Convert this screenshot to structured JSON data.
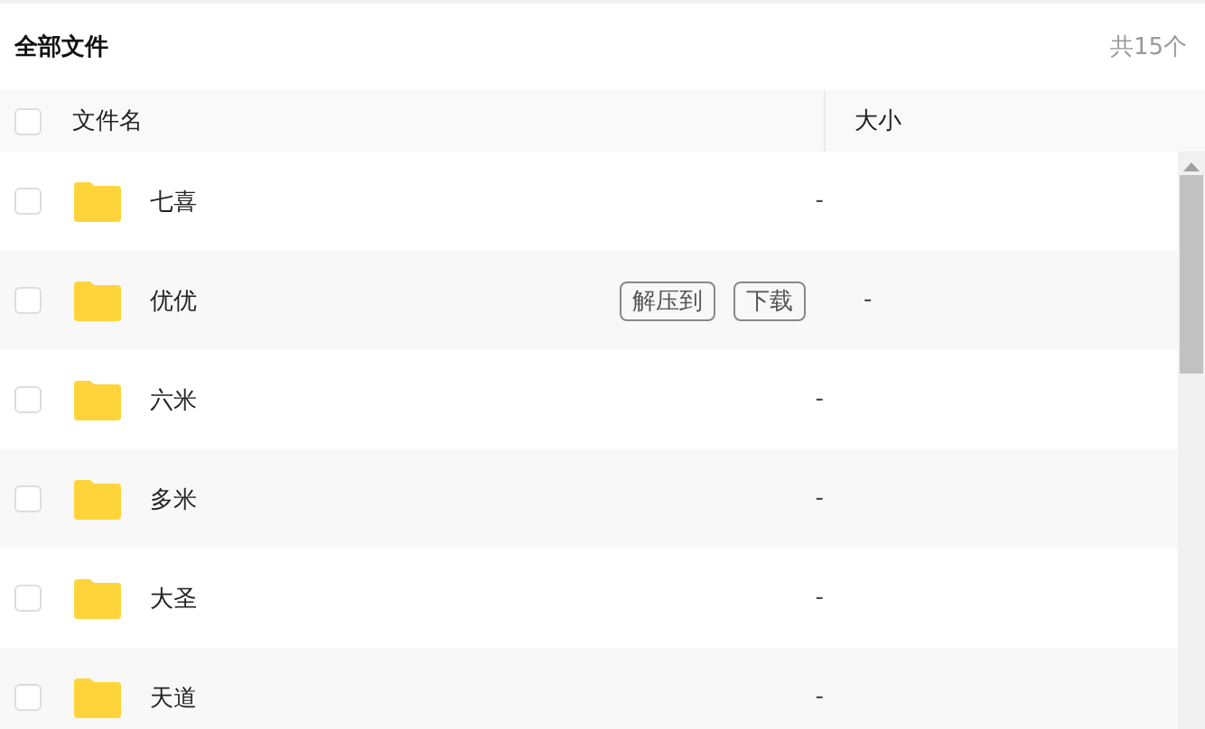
{
  "title": "全部文件",
  "count": "共15个",
  "header": {
    "checked": false,
    "columns": [
      "文件名",
      "大小"
    ]
  },
  "rows": [
    {
      "name": "七喜",
      "size": "-",
      "checked": false,
      "hovered": false
    },
    {
      "name": "优优",
      "size": "-",
      "checked": false,
      "hovered": true,
      "actions": [
        "解压到",
        "下载"
      ]
    },
    {
      "name": "六米",
      "size": "-",
      "checked": false,
      "hovered": false
    },
    {
      "name": "多米",
      "size": "-",
      "checked": false,
      "hovered": false
    },
    {
      "name": "大圣",
      "size": "-",
      "checked": false,
      "hovered": false
    },
    {
      "name": "天道",
      "size": "-",
      "checked": false,
      "hovered": false
    }
  ]
}
